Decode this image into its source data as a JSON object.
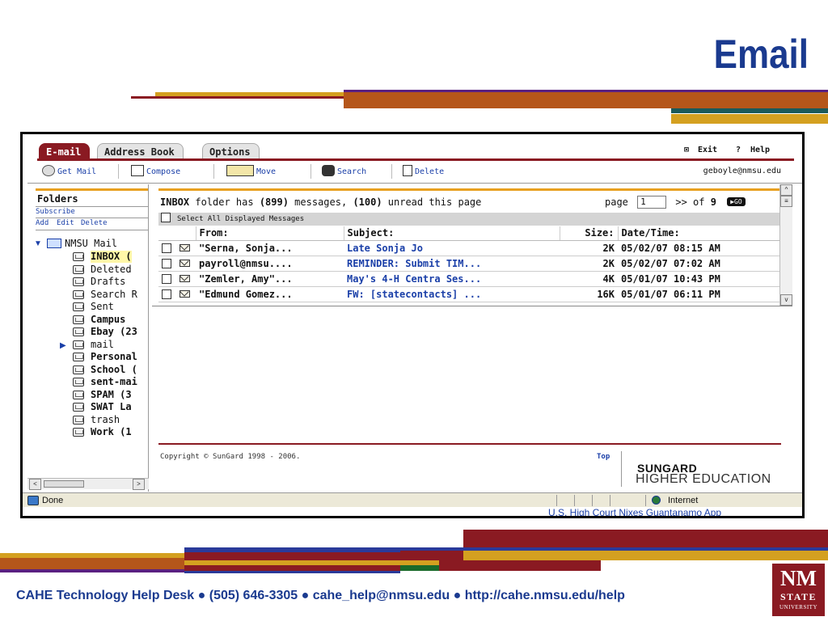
{
  "slide": {
    "title": "Email",
    "footer": "CAHE Technology Help Desk ● (505) 646-3305 ● cahe_help@nmsu.edu ● http://cahe.nmsu.edu/help",
    "logo": {
      "line1": "NM",
      "line2": "STATE",
      "line3": "UNIVERSITY"
    },
    "colors": {
      "title": "#1a3a8f",
      "crimson": "#8a1a22",
      "gold": "#d4a020",
      "navy": "#2a3a9a",
      "teal": "#1a5a5a",
      "green": "#1a6a2a"
    }
  },
  "app": {
    "tabs": [
      {
        "label": "E-mail",
        "active": true
      },
      {
        "label": "Address Book",
        "active": false
      },
      {
        "label": "Options",
        "active": false
      }
    ],
    "top_right": {
      "exit": "Exit",
      "help": "Help"
    },
    "toolbar": {
      "get_mail": "Get Mail",
      "compose": "Compose",
      "move": "Move",
      "search": "Search",
      "delete": "Delete",
      "user": "geboyle@nmsu.edu"
    },
    "sidebar": {
      "heading": "Folders",
      "subscribe": "Subscribe",
      "add": "Add",
      "edit": "Edit",
      "delete": "Delete",
      "root": "NMSU Mail",
      "folders": [
        {
          "label": "INBOX (",
          "bold": true,
          "icon": "inbox-icon"
        },
        {
          "label": "Deleted",
          "bold": false,
          "icon": "trash-icon"
        },
        {
          "label": "Drafts",
          "bold": false,
          "icon": "folder-icon"
        },
        {
          "label": "Search R",
          "bold": false,
          "icon": "folder-icon"
        },
        {
          "label": "Sent",
          "bold": false,
          "icon": "folder-icon"
        },
        {
          "label": "Campus",
          "bold": true,
          "icon": "folder-icon"
        },
        {
          "label": "Ebay (23",
          "bold": true,
          "icon": "folder-icon"
        },
        {
          "label": "mail",
          "bold": false,
          "icon": "folder-icon"
        },
        {
          "label": "Personal",
          "bold": true,
          "icon": "folder-icon"
        },
        {
          "label": "School (",
          "bold": true,
          "icon": "folder-icon"
        },
        {
          "label": "sent-mai",
          "bold": true,
          "icon": "folder-icon"
        },
        {
          "label": "SPAM (3",
          "bold": true,
          "icon": "folder-icon"
        },
        {
          "label": "SWAT La",
          "bold": true,
          "icon": "folder-icon"
        },
        {
          "label": "trash",
          "bold": false,
          "icon": "folder-icon"
        },
        {
          "label": "Work (1",
          "bold": true,
          "icon": "folder-icon"
        }
      ]
    },
    "main": {
      "summary": {
        "folder": "INBOX",
        "text1": " folder has ",
        "total": "(899)",
        "text2": " messages, ",
        "unread": "(100)",
        "text3": " unread this page"
      },
      "pager": {
        "label": "page",
        "value": "1",
        "of": ">> of",
        "total": "9",
        "go": "▶GO"
      },
      "select_all": "Select All Displayed Messages",
      "columns": [
        "From:",
        "Subject:",
        "Size:",
        "Date/Time:"
      ],
      "rows": [
        {
          "from": "\"Serna, Sonja...",
          "subject": "Late Sonja Jo",
          "size": "2K",
          "date": "05/02/07 08:15 AM"
        },
        {
          "from": "payroll@nmsu....",
          "subject": "REMINDER: Submit TIM...",
          "size": "2K",
          "date": "05/02/07 07:02 AM"
        },
        {
          "from": "\"Zemler, Amy\"...",
          "subject": "May's 4-H Centra Ses...",
          "size": "4K",
          "date": "05/01/07 10:43 PM"
        },
        {
          "from": "\"Edmund Gomez...",
          "subject": "FW: [statecontacts] ...",
          "size": "16K",
          "date": "05/01/07 06:11 PM"
        }
      ],
      "copyright": "Copyright © SunGard 1998 - 2006.",
      "top_link": "Top",
      "brand1": "SUNGARD",
      "brand2": "HIGHER EDUCATION"
    },
    "status": {
      "text": "Done",
      "zone": "Internet"
    },
    "behind_text": "U.S. High Court Nixes Guantanamo App"
  }
}
